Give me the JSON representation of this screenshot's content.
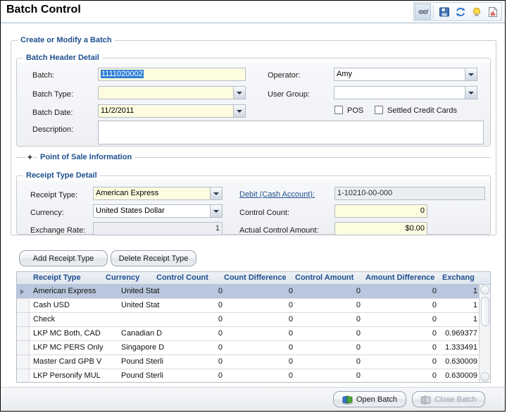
{
  "window": {
    "title": "Batch Control"
  },
  "toolbar": {
    "items": [
      {
        "name": "attach-icon",
        "label": "Attachments"
      },
      {
        "name": "save-icon",
        "label": "Save"
      },
      {
        "name": "refresh-icon",
        "label": "Refresh"
      },
      {
        "name": "hint-icon",
        "label": "Hints"
      },
      {
        "name": "report-icon",
        "label": "Report"
      }
    ]
  },
  "groups": {
    "create_modify": "Create or Modify a Batch",
    "batch_header": "Batch Header Detail",
    "receipt_type_detail": "Receipt Type Detail",
    "point_of_sale": "Point of Sale Information",
    "pos_expander": "+"
  },
  "batch_header": {
    "batch_label": "Batch:",
    "batch_value": "1111020002",
    "batch_type_label": "Batch Type:",
    "batch_type_value": "",
    "batch_date_label": "Batch Date:",
    "batch_date_value": "11/2/2011",
    "description_label": "Description:",
    "description_value": "",
    "operator_label": "Operator:",
    "operator_value": "Amy",
    "user_group_label": "User Group:",
    "user_group_value": "",
    "pos_checkbox_label": "POS",
    "pos_checked": false,
    "settled_checkbox_label": "Settled Credit Cards",
    "settled_checked": false
  },
  "receipt_detail": {
    "receipt_type_label": "Receipt Type:",
    "receipt_type_value": "American Express",
    "currency_label": "Currency:",
    "currency_value": "United States Dollar",
    "exchange_rate_label": "Exchange Rate:",
    "exchange_rate_value": "1",
    "debit_link_label": "Debit (Cash Account):",
    "debit_account_value": "1-10210-00-000",
    "control_count_label": "Control Count:",
    "control_count_value": "0",
    "actual_control_amount_label": "Actual Control Amount:",
    "actual_control_amount_value": "$0.00"
  },
  "actions": {
    "add_receipt_type": "Add Receipt Type",
    "delete_receipt_type": "Delete Receipt Type",
    "open_batch": "Open Batch",
    "close_batch": "Close Batch",
    "close_batch_disabled": true
  },
  "grid": {
    "columns": [
      "Receipt Type",
      "Currency",
      "Control Count",
      "Count Difference",
      "Control Amount",
      "Amount Difference",
      "Exchang"
    ],
    "rows": [
      {
        "receipt_type": "American Express",
        "currency": "United Stat",
        "control_count": "0",
        "count_difference": "0",
        "control_amount": "0",
        "amount_difference": "0",
        "exchange": "1",
        "selected": true
      },
      {
        "receipt_type": "Cash USD",
        "currency": "United Stat",
        "control_count": "0",
        "count_difference": "0",
        "control_amount": "0",
        "amount_difference": "0",
        "exchange": "1",
        "selected": false
      },
      {
        "receipt_type": "Check",
        "currency": "",
        "control_count": "0",
        "count_difference": "0",
        "control_amount": "0",
        "amount_difference": "0",
        "exchange": "1",
        "selected": false
      },
      {
        "receipt_type": "LKP MC Both, CAD",
        "currency": "Canadian D",
        "control_count": "0",
        "count_difference": "0",
        "control_amount": "0",
        "amount_difference": "0",
        "exchange": "0.969377",
        "selected": false
      },
      {
        "receipt_type": "LKP MC PERS Only",
        "currency": "Singapore D",
        "control_count": "0",
        "count_difference": "0",
        "control_amount": "0",
        "amount_difference": "0",
        "exchange": "1.333491",
        "selected": false
      },
      {
        "receipt_type": "Master Card GPB V",
        "currency": "Pound Sterli",
        "control_count": "0",
        "count_difference": "0",
        "control_amount": "0",
        "amount_difference": "0",
        "exchange": "0.630009",
        "selected": false
      },
      {
        "receipt_type": "LKP Personify MUL",
        "currency": "Pound Sterli",
        "control_count": "0",
        "count_difference": "0",
        "control_amount": "0",
        "amount_difference": "0",
        "exchange": "0.630009",
        "selected": false
      }
    ]
  },
  "colors": {
    "legend_blue": "#1f4f8f",
    "field_yellow": "#fdfce0",
    "selection_blue": "#2f7fd8",
    "row_selected": "#b8c7dd"
  }
}
